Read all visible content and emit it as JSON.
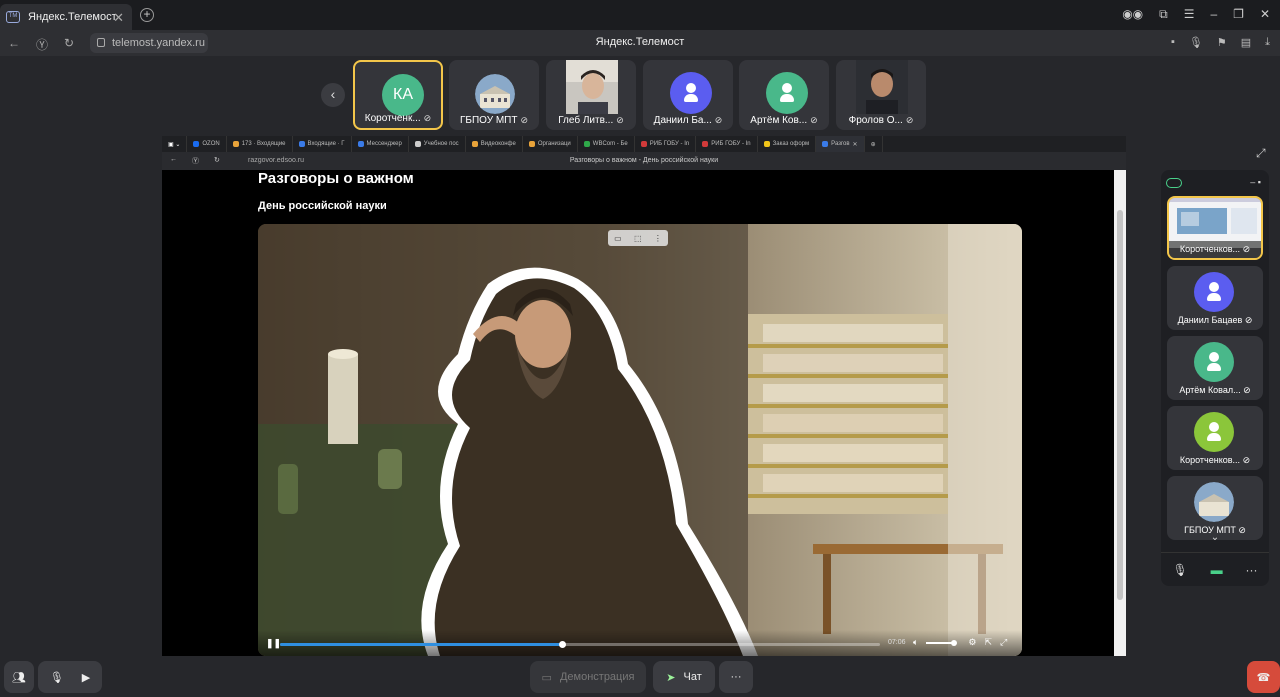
{
  "browser": {
    "tab_title": "Яндекс.Телемост",
    "url": "telemost.yandex.ru",
    "page_title": "Яндекс.Телемост",
    "tab_close": "✕",
    "new_tab": "+"
  },
  "strip": {
    "participants": [
      {
        "name": "Коротченк...",
        "avatar_text": "КА",
        "avatar_color": "#49b88a",
        "type": "initials",
        "active": true
      },
      {
        "name": "ГБПОУ МПТ",
        "type": "building"
      },
      {
        "name": "Глеб Литв...",
        "type": "photo"
      },
      {
        "name": "Даниил Ба...",
        "avatar_color": "#5b5df0",
        "type": "person"
      },
      {
        "name": "Артём Ков...",
        "avatar_color": "#49b88a",
        "type": "person"
      },
      {
        "name": "Фролов О...",
        "type": "photo"
      }
    ]
  },
  "shared_screen": {
    "tabs": [
      {
        "label": "OZON",
        "color": "#1a6cf0"
      },
      {
        "label": "173 · Входящие",
        "color": "#e8a33a"
      },
      {
        "label": "Входящие · Г",
        "color": "#3a7be8"
      },
      {
        "label": "Мессенджер",
        "color": "#3a7be8"
      },
      {
        "label": "Учебное пос",
        "color": "#cccccc"
      },
      {
        "label": "Видеоконфе",
        "color": "#e8a33a"
      },
      {
        "label": "Организаци",
        "color": "#e8a33a"
      },
      {
        "label": "WBCom - Бе",
        "color": "#2fa84a"
      },
      {
        "label": "РИБ ГОБУ - In",
        "color": "#d23a3a"
      },
      {
        "label": "РИБ ГОБУ - In",
        "color": "#d23a3a"
      },
      {
        "label": "Заказ оформ",
        "color": "#f0c419"
      },
      {
        "label": "Разгов",
        "color": "#3a7be8"
      }
    ],
    "url": "razgovor.edsoo.ru",
    "page_title": "Разговоры о важном - День российской науки",
    "heading": "Разговоры о важном",
    "subheading": "День российской науки",
    "video": {
      "time": "07:06",
      "progress": 0.47,
      "volume": 0.9
    }
  },
  "right_panel": {
    "participants": [
      {
        "name": "Коротченков...",
        "type": "screen",
        "active": true
      },
      {
        "name": "Даниил Бацаев",
        "avatar_color": "#5b5df0",
        "type": "person"
      },
      {
        "name": "Артём Ковал...",
        "avatar_color": "#49b88a",
        "type": "person"
      },
      {
        "name": "Коротченков...",
        "avatar_color": "#8bc63a",
        "type": "person"
      },
      {
        "name": "ГБПОУ МПТ",
        "type": "building"
      }
    ]
  },
  "bottom": {
    "demo_label": "Демонстрация",
    "chat_label": "Чат",
    "more_label": "···"
  },
  "colors": {
    "accent_active": "#f3c64a",
    "end_call": "#d64b3b",
    "progress": "#2f8fe0"
  }
}
